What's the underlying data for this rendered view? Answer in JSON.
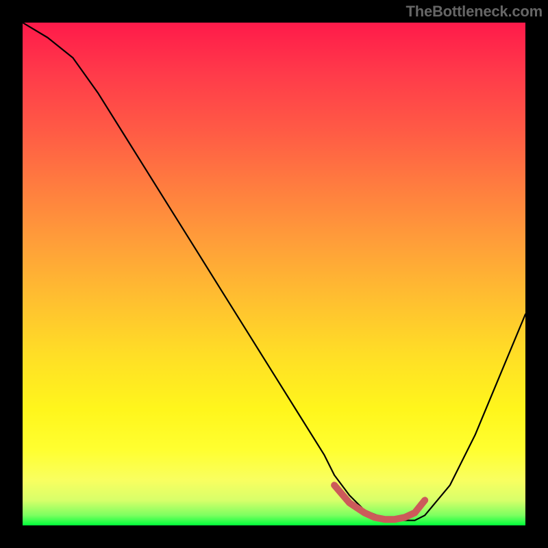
{
  "attribution": "TheBottleneck.com",
  "colors": {
    "background": "#000000",
    "curve_black": "#000000",
    "red_segment": "#cc5a5a",
    "attribution_text": "#666666"
  },
  "chart_data": {
    "type": "line",
    "title": "",
    "xlabel": "",
    "ylabel": "",
    "xlim": [
      0,
      100
    ],
    "ylim": [
      0,
      100
    ],
    "x": [
      0,
      5,
      10,
      15,
      20,
      25,
      30,
      35,
      40,
      45,
      50,
      55,
      60,
      62,
      65,
      68,
      73,
      78,
      80,
      85,
      90,
      95,
      100
    ],
    "values": [
      100,
      97,
      93,
      86,
      78,
      70,
      62,
      54,
      46,
      38,
      30,
      22,
      14,
      10,
      6,
      3,
      1,
      1,
      2,
      8,
      18,
      30,
      42
    ],
    "highlight_segment": {
      "color": "#cc5a5a",
      "x": [
        62,
        65,
        68,
        70,
        72,
        74,
        76,
        78,
        80
      ],
      "values": [
        8,
        4.5,
        2.5,
        1.6,
        1.2,
        1.2,
        1.6,
        2.5,
        5
      ]
    },
    "note": "Black V-shaped curve over vertical red-to-green gradient. Lower portion near the minimum is re-drawn as a thicker salmon/red segment."
  }
}
